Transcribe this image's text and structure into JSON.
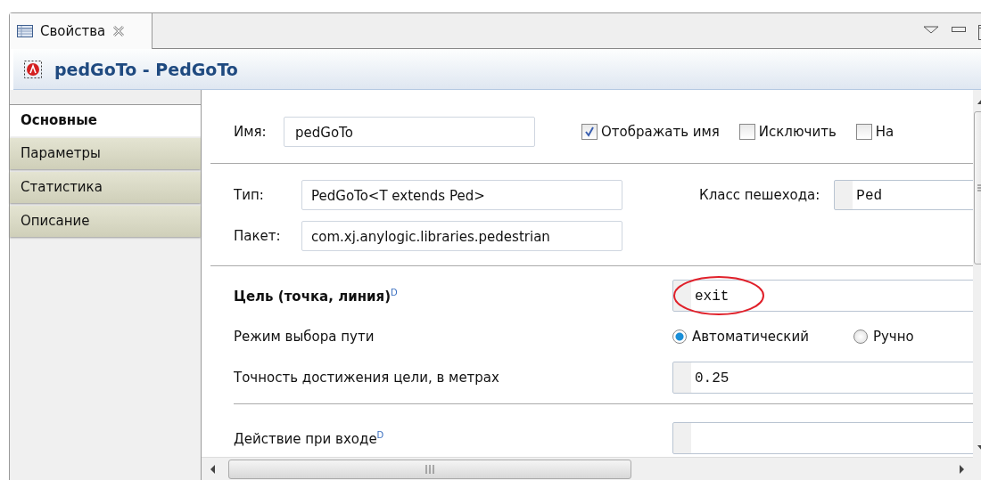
{
  "tab": {
    "label": "Свойства"
  },
  "title": "pedGoTo - PedGoTo",
  "sidebar": [
    {
      "label": "Основные",
      "selected": true
    },
    {
      "label": "Параметры",
      "selected": false
    },
    {
      "label": "Статистика",
      "selected": false
    },
    {
      "label": "Описание",
      "selected": false
    }
  ],
  "name": {
    "label": "Имя:",
    "value": "pedGoTo"
  },
  "options": [
    {
      "label": "Отображать имя",
      "checked": true
    },
    {
      "label": "Исключить",
      "checked": false
    },
    {
      "label": "На",
      "checked": false
    }
  ],
  "type": {
    "label": "Тип:",
    "value": "PedGoTo<T extends Ped>"
  },
  "package": {
    "label": "Пакет:",
    "value": "com.xj.anylogic.libraries.pedestrian"
  },
  "ped_class": {
    "label": "Класс пешехода:",
    "value": "Ped"
  },
  "goal": {
    "label": "Цель (точка, линия)$^{D}$",
    "value": "exit"
  },
  "route_mode": {
    "label": "Режим выбора пути",
    "options": [
      {
        "label": "Автоматический",
        "selected": true
      },
      {
        "label": "Ручно",
        "selected": false
      }
    ]
  },
  "accuracy": {
    "label": "Точность достижения цели, в метрах",
    "value": "0.25"
  },
  "entry_action": {
    "label": "Действие при входе$^{D}$"
  }
}
